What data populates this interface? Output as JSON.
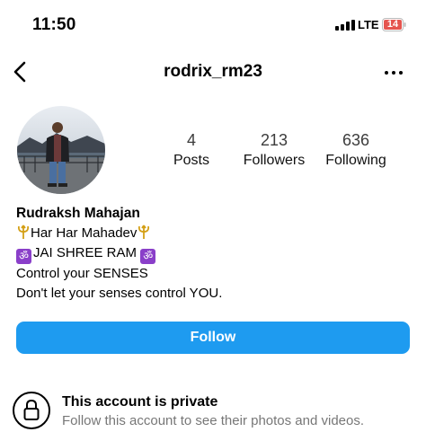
{
  "status_bar": {
    "time": "11:50",
    "network": "LTE",
    "battery": "14",
    "battery_color": "#e5554f"
  },
  "header": {
    "username": "rodrix_rm23",
    "back_icon": "chevron-left-icon",
    "more_icon": "more-horizontal-icon"
  },
  "stats": [
    {
      "count": "4",
      "label": "Posts"
    },
    {
      "count": "213",
      "label": "Followers"
    },
    {
      "count": "636",
      "label": "Following"
    }
  ],
  "bio": {
    "name": "Rudraksh Mahajan",
    "line1": "Har Har Mahadev",
    "line2": "JAI SHREE RAM",
    "line3": "Control your SENSES",
    "line4": "Don't let your senses control YOU."
  },
  "follow_button": {
    "label": "Follow",
    "color": "#1e9bf0"
  },
  "private": {
    "title": "This account is private",
    "subtitle": "Follow this account to see their photos and videos."
  }
}
